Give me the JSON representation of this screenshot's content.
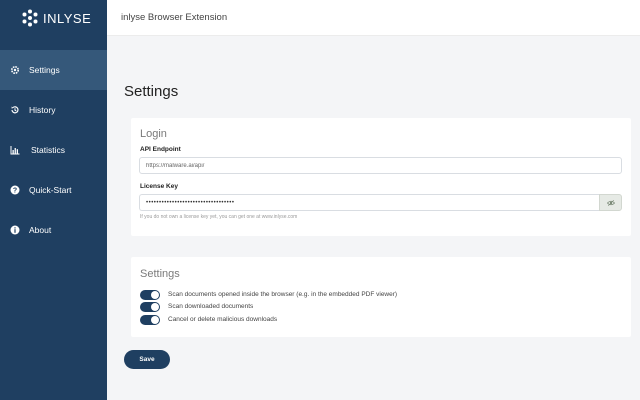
{
  "brand": {
    "name": "INLYSE"
  },
  "topbar": {
    "title": "inlyse Browser Extension"
  },
  "sidebar": {
    "items": [
      {
        "label": "Settings",
        "icon": "gear-icon",
        "active": true
      },
      {
        "label": "History",
        "icon": "history-icon",
        "active": false
      },
      {
        "label": "Statistics",
        "icon": "bar-chart-icon",
        "active": false
      },
      {
        "label": "Quick-Start",
        "icon": "question-icon",
        "active": false
      },
      {
        "label": "About",
        "icon": "info-icon",
        "active": false
      }
    ]
  },
  "main": {
    "title": "Settings",
    "login": {
      "heading": "Login",
      "api_label": "API Endpoint",
      "api_value": "https://malware.ai/api/",
      "key_label": "License Key",
      "key_value": "••••••••••••••••••••••••••••••••••",
      "hint": "If you do not own a license key yet, you can get one at www.inlyse.com"
    },
    "settings": {
      "heading": "Settings",
      "toggles": [
        {
          "label": "Scan documents opened inside the browser (e.g. in the embedded PDF viewer)",
          "on": true
        },
        {
          "label": "Scan downloaded documents",
          "on": true
        },
        {
          "label": "Cancel or delete malicious downloads",
          "on": true
        }
      ]
    },
    "save_label": "Save"
  },
  "colors": {
    "sidebar": "#1f3f61",
    "sidebar_active": "#35587a",
    "background": "#f4f5f7"
  }
}
